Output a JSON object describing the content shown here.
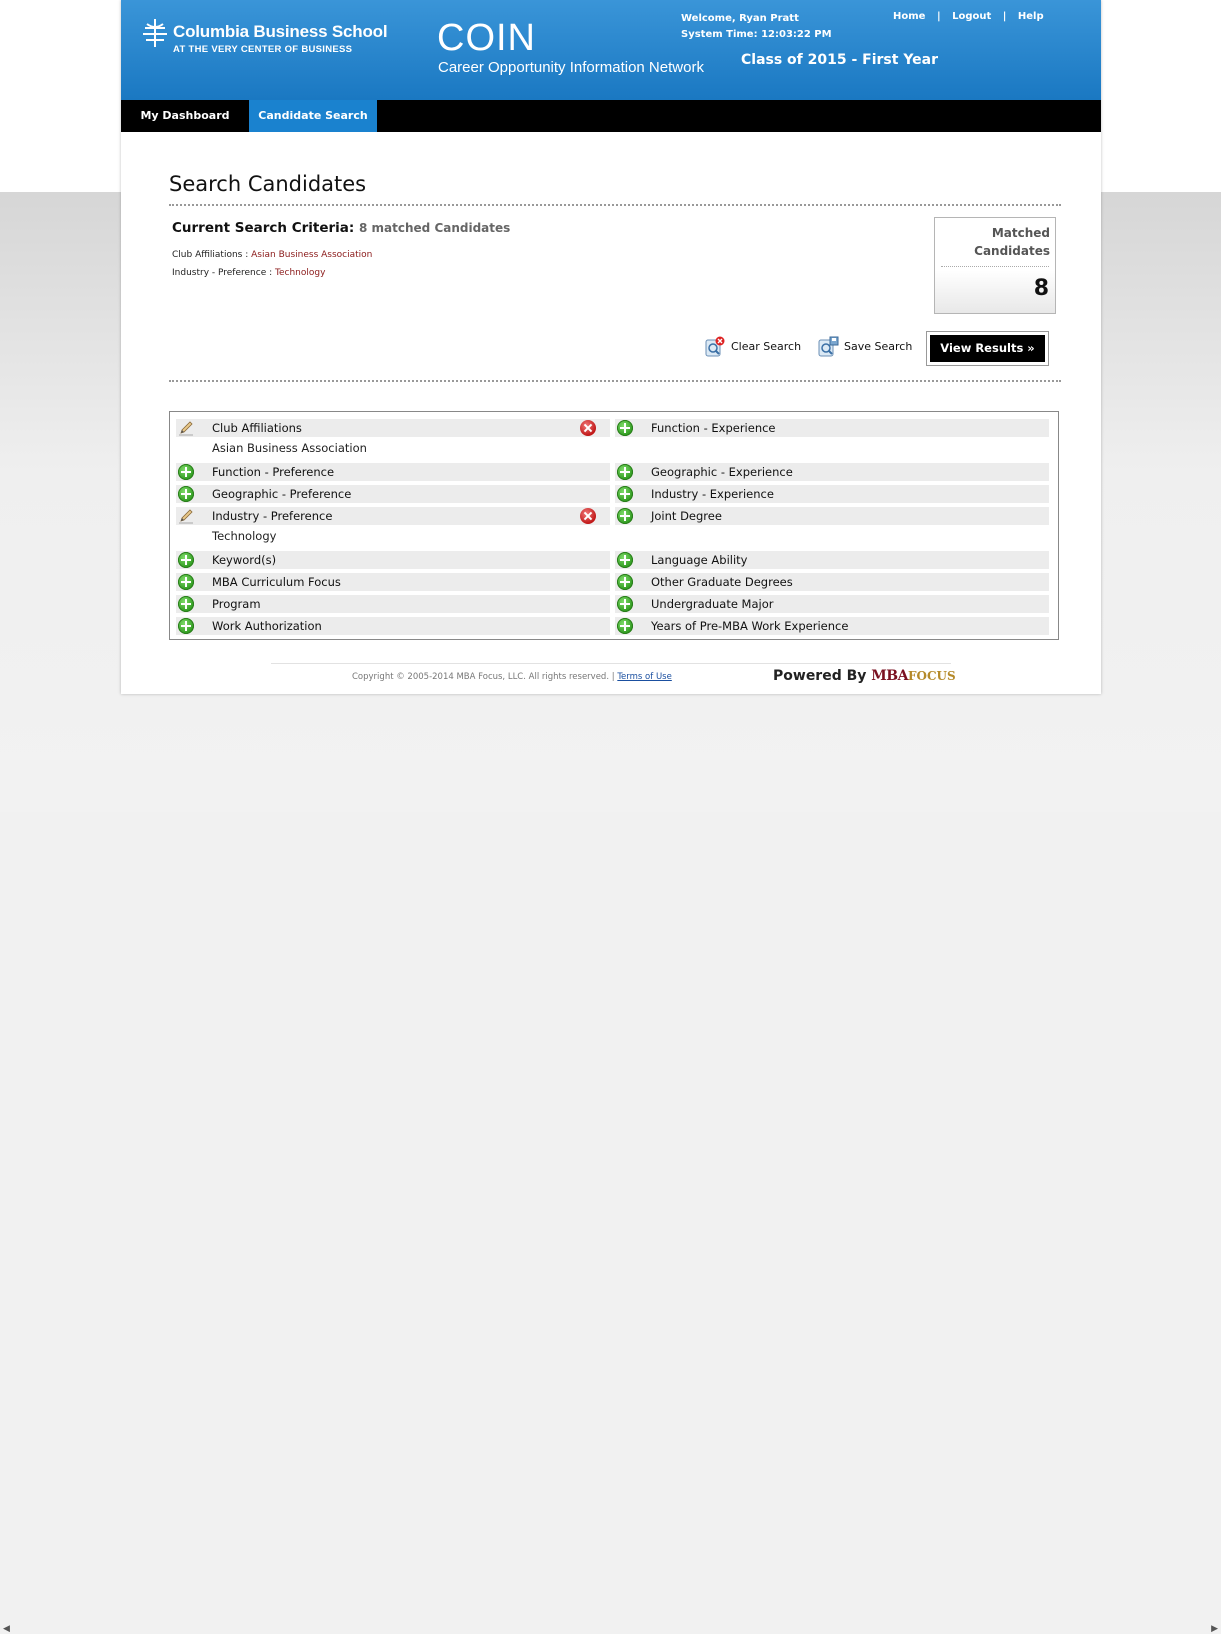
{
  "header": {
    "school_name": "Columbia Business School",
    "school_tagline": "AT THE VERY CENTER OF BUSINESS",
    "app_title": "COIN",
    "app_subtitle": "Career Opportunity Information Network",
    "welcome": "Welcome, Ryan Pratt",
    "system_time": "System Time: 12:03:22 PM",
    "class_label": "Class of 2015 - First Year",
    "links": [
      "Home",
      "Logout",
      "Help"
    ],
    "separator": "|"
  },
  "nav": {
    "tabs": [
      {
        "label": "My Dashboard",
        "active": false
      },
      {
        "label": "Candidate Search",
        "active": true
      }
    ]
  },
  "page_title": "Search Candidates",
  "criteria": {
    "heading": "Current Search Criteria:",
    "count_text": "8 matched Candidates",
    "lines": [
      {
        "name": "Club Affiliations :",
        "value": "Asian Business Association"
      },
      {
        "name": "Industry - Preference :",
        "value": "Technology"
      }
    ]
  },
  "matched_box": {
    "label_line1": "Matched",
    "label_line2": "Candidates",
    "count": "8"
  },
  "actions": {
    "clear": "Clear Search",
    "save": "Save Search",
    "view": "View Results »"
  },
  "filters": {
    "left": [
      {
        "label": "Club Affiliations",
        "value": "Asian Business Association",
        "selected": true
      },
      {
        "label": "Function - Preference"
      },
      {
        "label": "Geographic - Preference"
      },
      {
        "label": "Industry - Preference",
        "value": "Technology",
        "selected": true
      },
      {
        "label": "Keyword(s)"
      },
      {
        "label": "MBA Curriculum Focus"
      },
      {
        "label": "Program"
      },
      {
        "label": "Work Authorization"
      }
    ],
    "right": [
      {
        "label": "Function - Experience"
      },
      {
        "label": "Geographic - Experience"
      },
      {
        "label": "Industry - Experience"
      },
      {
        "label": "Joint Degree"
      },
      {
        "label": "Language Ability"
      },
      {
        "label": "Other Graduate Degrees"
      },
      {
        "label": "Undergraduate Major"
      },
      {
        "label": "Years of Pre-MBA Work Experience"
      }
    ]
  },
  "footer": {
    "copyright": "Copyright © 2005-2014 MBA Focus, LLC. All rights reserved. |",
    "terms": "Terms of Use",
    "powered_by": "Powered By",
    "brand_1": "MBA",
    "brand_2": "FOCUS"
  },
  "colors": {
    "header_blue": "#1a78c2",
    "active_tab": "#1a82cf",
    "criteria_value": "#8b1a1a"
  }
}
